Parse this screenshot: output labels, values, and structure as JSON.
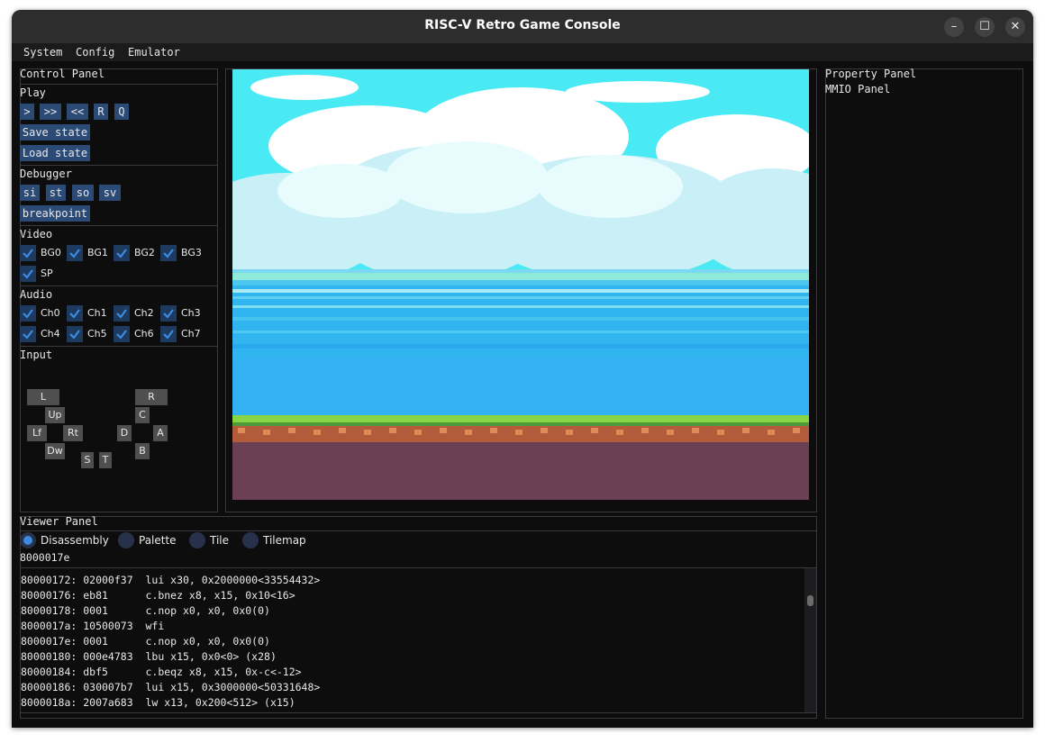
{
  "window": {
    "title": "RISC-V Retro Game Console"
  },
  "window_controls": {
    "minimize": "–",
    "maximize": "☐",
    "close": "✕"
  },
  "menu": {
    "items": [
      "System",
      "Config",
      "Emulator"
    ]
  },
  "control_panel": {
    "title": "Control Panel",
    "play": {
      "title": "Play",
      "buttons": [
        ">",
        ">>",
        "<<",
        "R",
        "Q"
      ],
      "save_state": "Save state",
      "load_state": "Load state"
    },
    "debugger": {
      "title": "Debugger",
      "buttons": [
        "si",
        "st",
        "so",
        "sv"
      ],
      "breakpoint": "breakpoint"
    },
    "video": {
      "title": "Video",
      "layers": [
        "BG0",
        "BG1",
        "BG2",
        "BG3",
        "SP"
      ]
    },
    "audio": {
      "title": "Audio",
      "channels": [
        "Ch0",
        "Ch1",
        "Ch2",
        "Ch3",
        "Ch4",
        "Ch5",
        "Ch6",
        "Ch7"
      ]
    },
    "input": {
      "title": "Input",
      "keys": {
        "l": "L",
        "r": "R",
        "up": "Up",
        "c": "C",
        "lf": "Lf",
        "rt": "Rt",
        "d": "D",
        "a": "A",
        "dw": "Dw",
        "b": "B",
        "s": "S",
        "t": "T"
      }
    }
  },
  "property_panel": {
    "title": "Property Panel",
    "sub": "MMIO Panel"
  },
  "viewer_panel": {
    "title": "Viewer Panel",
    "tabs": [
      "Disassembly",
      "Palette",
      "Tile",
      "Tilemap"
    ],
    "selected_tab": "Disassembly",
    "current_address": "8000017e",
    "lines": [
      "80000172: 02000f37  lui x30, 0x2000000<33554432>",
      "80000176: eb81      c.bnez x8, x15, 0x10<16>",
      "80000178: 0001      c.nop x0, x0, 0x0(0)",
      "8000017a: 10500073  wfi",
      "8000017e: 0001      c.nop x0, x0, 0x0(0)",
      "80000180: 000e4783  lbu x15, 0x0<0> (x28)",
      "80000184: dbf5      c.beqz x8, x15, 0x-c<-12>",
      "80000186: 030007b7  lui x15, 0x3000000<50331648>",
      "8000018a: 2007a683  lw x13, 0x200<512> (x15)"
    ]
  },
  "colors": {
    "sky": "#4aeaf5",
    "cloud": "#c9f0f6",
    "sea": "#31b5f1",
    "grass": "#87d544",
    "soil": "#6b3f56",
    "dirt": "#b25c3c",
    "checkbox_check": "#3c8be3",
    "button": "#2b4a75"
  },
  "icons": {
    "checkbox": "check-icon",
    "close": "close-icon",
    "minimize": "minimize-icon",
    "maximize": "maximize-icon"
  }
}
